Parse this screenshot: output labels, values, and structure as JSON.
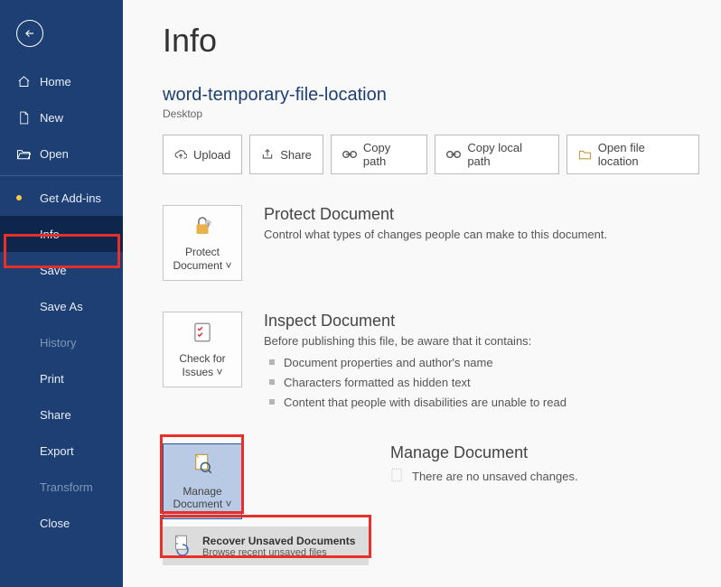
{
  "sidebar": {
    "items": [
      {
        "label": "Home"
      },
      {
        "label": "New"
      },
      {
        "label": "Open"
      },
      {
        "label": "Get Add-ins"
      },
      {
        "label": "Info"
      },
      {
        "label": "Save"
      },
      {
        "label": "Save As"
      },
      {
        "label": "History"
      },
      {
        "label": "Print"
      },
      {
        "label": "Share"
      },
      {
        "label": "Export"
      },
      {
        "label": "Transform"
      },
      {
        "label": "Close"
      }
    ]
  },
  "main": {
    "page_title": "Info",
    "doc_title": "word-temporary-file-location",
    "doc_subtitle": "Desktop",
    "buttons": {
      "upload": "Upload",
      "share": "Share",
      "copy_path": "Copy path",
      "copy_local_path": "Copy local path",
      "open_location": "Open file location"
    },
    "protect": {
      "tile_label": "Protect Document",
      "title": "Protect Document",
      "desc": "Control what types of changes people can make to this document."
    },
    "inspect": {
      "tile_label": "Check for Issues",
      "title": "Inspect Document",
      "desc": "Before publishing this file, be aware that it contains:",
      "bullets": [
        "Document properties and author's name",
        "Characters formatted as hidden text",
        "Content that people with disabilities are unable to read"
      ]
    },
    "manage": {
      "tile_label": "Manage Document",
      "title": "Manage Document",
      "status": "There are no unsaved changes."
    },
    "recover": {
      "title": "Recover Unsaved Documents",
      "subtitle": "Browse recent unsaved files"
    }
  }
}
